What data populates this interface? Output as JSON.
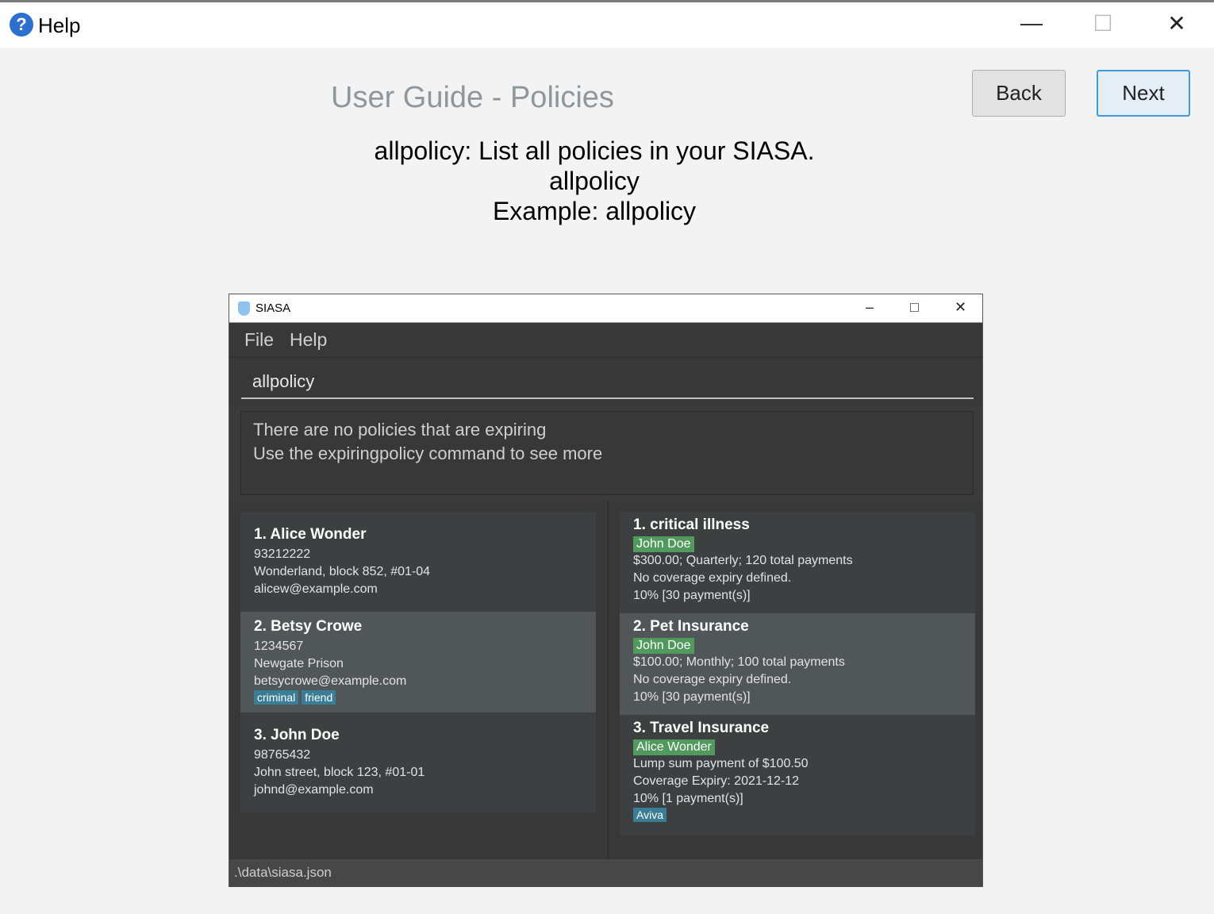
{
  "window": {
    "title": "Help",
    "icon": "help-icon"
  },
  "guide": {
    "heading": "User Guide - Policies",
    "back": "Back",
    "next": "Next",
    "lines": [
      "allpolicy: List all policies in your SIASA.",
      "allpolicy",
      "Example: allpolicy"
    ]
  },
  "app": {
    "title": "SIASA",
    "menu": [
      "File",
      "Help"
    ],
    "command": "allpolicy",
    "result": [
      "There are no policies that are expiring",
      "Use the expiringpolicy command to see more"
    ],
    "status": ".\\data\\siasa.json",
    "people": [
      {
        "title": "1.  Alice Wonder",
        "lines": [
          "93212222",
          "Wonderland, block 852, #01-04",
          "alicew@example.com"
        ],
        "tags": []
      },
      {
        "title": "2.  Betsy Crowe",
        "lines": [
          "1234567",
          "Newgate Prison",
          "betsycrowe@example.com"
        ],
        "tags": [
          "criminal",
          "friend"
        ]
      },
      {
        "title": "3.  John Doe",
        "lines": [
          "98765432",
          "John street, block 123, #01-01",
          "johnd@example.com"
        ],
        "tags": []
      }
    ],
    "policies": [
      {
        "title": "1.  critical illness",
        "owner": "John Doe",
        "lines": [
          "$300.00; Quarterly; 120 total payments",
          "No coverage expiry defined.",
          "10% [30 payment(s)]"
        ],
        "tags": []
      },
      {
        "title": "2.  Pet Insurance",
        "owner": "John Doe",
        "lines": [
          "$100.00; Monthly; 100 total payments",
          "No coverage expiry defined.",
          "10% [30 payment(s)]"
        ],
        "tags": []
      },
      {
        "title": "3.  Travel Insurance",
        "owner": "Alice Wonder",
        "lines": [
          "Lump sum payment of $100.50",
          "Coverage Expiry: 2021-12-12",
          "10% [1 payment(s)]"
        ],
        "tags": [
          "Aviva"
        ]
      }
    ]
  }
}
